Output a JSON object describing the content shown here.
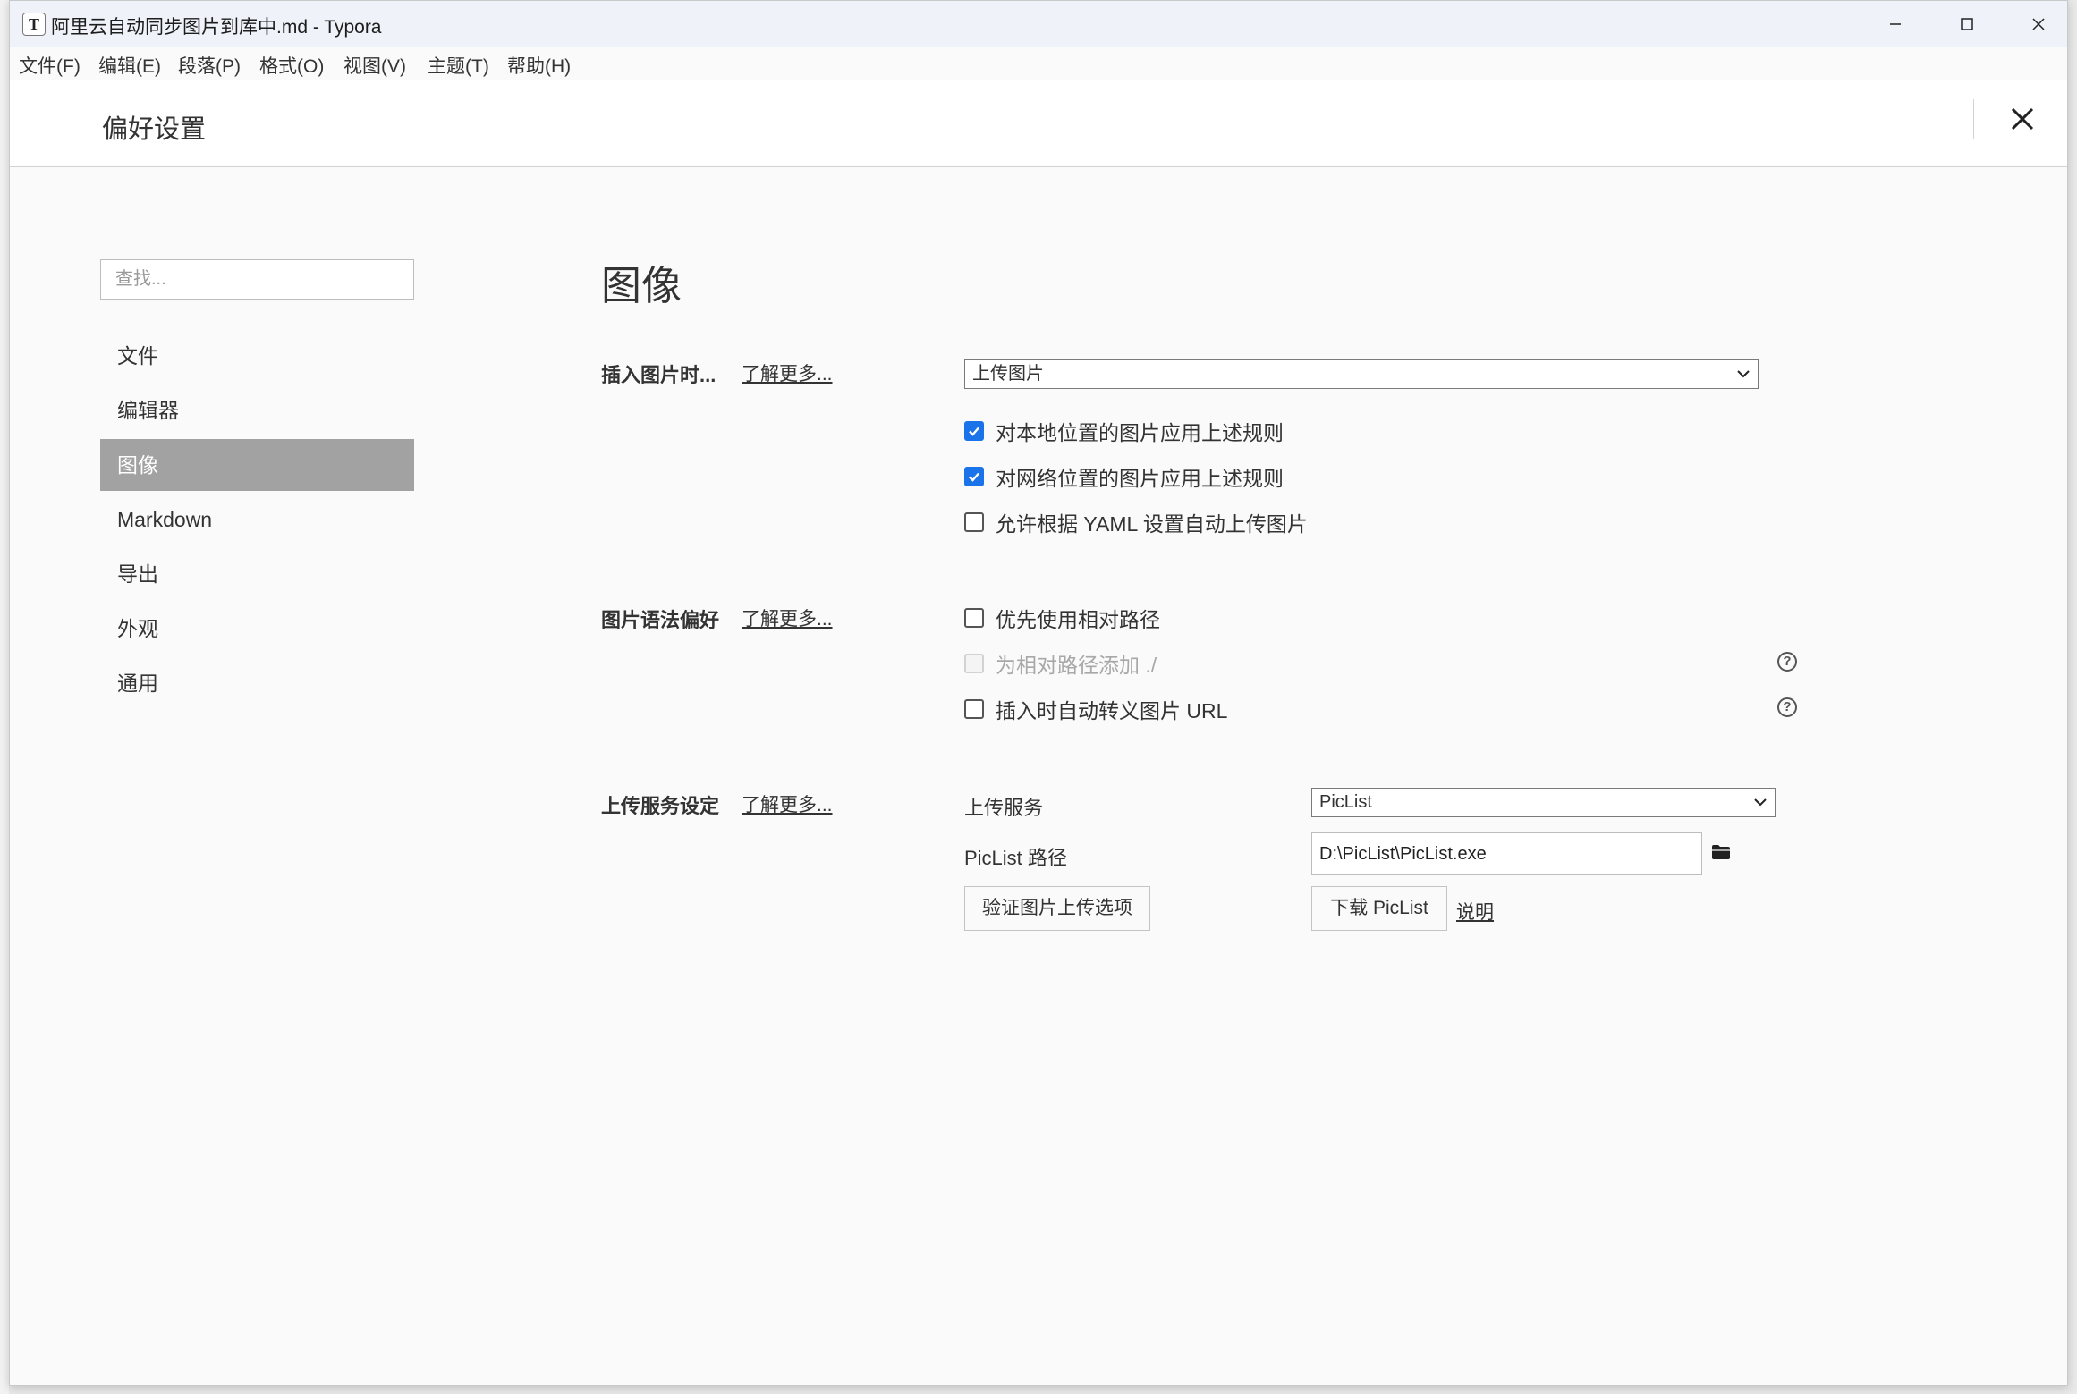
{
  "window": {
    "title": "阿里云自动同步图片到库中.md - Typora",
    "app_icon": "T"
  },
  "menubar": {
    "items": [
      "文件(F)",
      "编辑(E)",
      "段落(P)",
      "格式(O)",
      "视图(V)",
      "主题(T)",
      "帮助(H)"
    ]
  },
  "prefs": {
    "title": "偏好设置"
  },
  "sidebar": {
    "search_placeholder": "查找...",
    "items": [
      {
        "label": "文件"
      },
      {
        "label": "编辑器"
      },
      {
        "label": "图像",
        "active": true
      },
      {
        "label": "Markdown"
      },
      {
        "label": "导出"
      },
      {
        "label": "外观"
      },
      {
        "label": "通用"
      }
    ]
  },
  "content": {
    "section_title": "图像",
    "insert": {
      "label": "插入图片时...",
      "learn_more": "了解更多...",
      "select_value": "上传图片",
      "options": [
        {
          "label": "对本地位置的图片应用上述规则",
          "checked": true
        },
        {
          "label": "对网络位置的图片应用上述规则",
          "checked": true
        },
        {
          "label": "允许根据 YAML 设置自动上传图片",
          "checked": false
        }
      ]
    },
    "syntax": {
      "label": "图片语法偏好",
      "learn_more": "了解更多...",
      "options": [
        {
          "label": "优先使用相对路径",
          "checked": false,
          "disabled": false
        },
        {
          "label": "为相对路径添加 ./",
          "checked": false,
          "disabled": true
        },
        {
          "label": "插入时自动转义图片 URL",
          "checked": false,
          "disabled": false
        }
      ],
      "help_glyph": "?"
    },
    "upload": {
      "label": "上传服务设定",
      "learn_more": "了解更多...",
      "service_label": "上传服务",
      "service_value": "PicList",
      "path_label": "PicList 路径",
      "path_value": "D:\\PicList\\PicList.exe",
      "verify_button": "验证图片上传选项",
      "download_button": "下载 PicList",
      "docs_link": "说明"
    }
  },
  "colors": {
    "checkbox_checked": "#1a73e8",
    "nav_active_bg": "#a2a2a2",
    "titlebar_bg": "#eff3f9",
    "content_bg": "#fafafa"
  },
  "icons": {
    "close": "close-icon",
    "minimize": "minimize-icon",
    "maximize": "maximize-icon",
    "chevron": "chevron-down-icon",
    "folder": "folder-icon",
    "help": "help-icon",
    "check": "check-icon"
  }
}
